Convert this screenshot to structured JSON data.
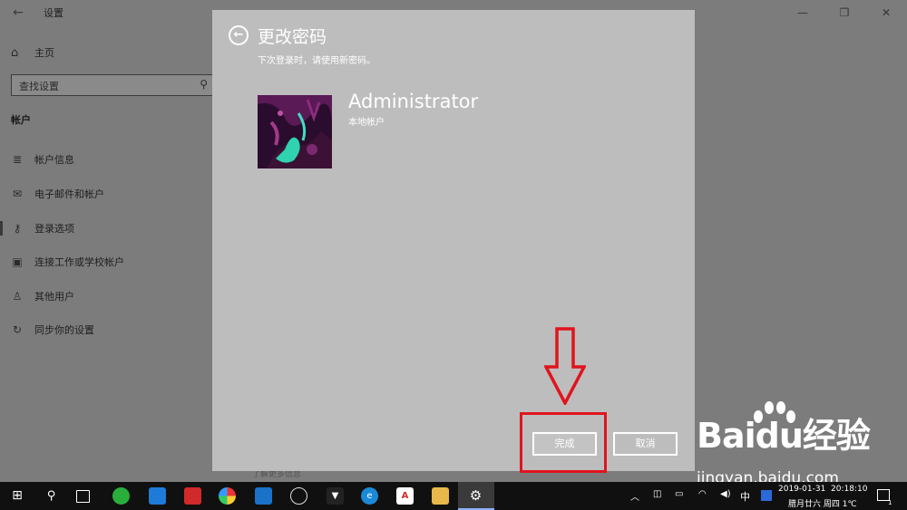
{
  "settings_window": {
    "title": "设置",
    "back_glyph": "←",
    "controls": {
      "minimize": "—",
      "maximize": "❐",
      "close": "✕"
    },
    "home_label": "主页",
    "search_placeholder": "查找设置",
    "section_title": "帐户",
    "nav_items": [
      {
        "label": "帐户信息",
        "icon": "person-card-icon"
      },
      {
        "label": "电子邮件和帐户",
        "icon": "mail-icon"
      },
      {
        "label": "登录选项",
        "icon": "key-icon",
        "active": true
      },
      {
        "label": "连接工作或学校帐户",
        "icon": "briefcase-icon"
      },
      {
        "label": "其他用户",
        "icon": "person-icon"
      },
      {
        "label": "同步你的设置",
        "icon": "sync-icon"
      }
    ],
    "hidden_link": "了解更多信息"
  },
  "dialog": {
    "title": "更改密码",
    "subtitle": "下次登录时，请使用新密码。",
    "account_name": "Administrator",
    "account_type": "本地帐户",
    "done_button": "完成",
    "cancel_button": "取消"
  },
  "watermark": {
    "logo_text_1": "Bai",
    "logo_text_2": "du",
    "logo_text_3": "经验",
    "url": "jingyan.baidu.com"
  },
  "taskbar": {
    "pinned_apps": [
      "search-icon",
      "task-view-icon",
      "wechat-icon",
      "mail-app-icon",
      "it-app-icon",
      "color-app-icon",
      "calendar-app-icon",
      "qq-icon",
      "fox-app-icon",
      "ie-icon",
      "pdf-app-icon",
      "file-explorer-icon",
      "settings-icon"
    ],
    "tray": {
      "ime": "中",
      "date": "2019-01-31",
      "time": "20:18:10",
      "lunar": "腊月廿六 周四 1℃",
      "notifications_count": "1"
    }
  },
  "colors": {
    "annotation_red": "#e0141e",
    "dialog_bg": "#bdbdbd",
    "taskbar_bg": "#101010"
  }
}
